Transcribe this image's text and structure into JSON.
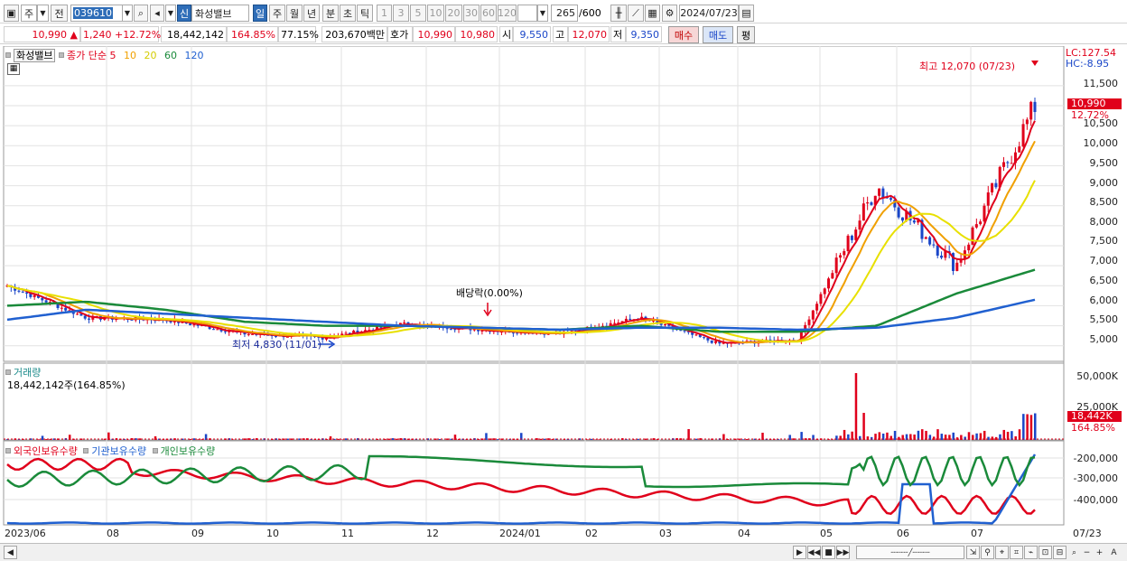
{
  "toolbar": {
    "period_main": "주",
    "prev_label": "전",
    "code": "039610",
    "brand_tag": "신",
    "stock_name": "화성밸브",
    "periods": [
      "일",
      "주",
      "월",
      "년",
      "분",
      "초",
      "틱"
    ],
    "active_period": "일",
    "intervals": [
      "1",
      "3",
      "5",
      "10",
      "20",
      "30",
      "60",
      "120"
    ],
    "count": "265",
    "count_max": "/600",
    "date": "2024/07/23"
  },
  "quote": {
    "price": "10,990",
    "price_arrow": "▲",
    "change": "1,240",
    "change_pct": "+12.72%",
    "volume": "18,442,142",
    "volume_ratio": "164.85%",
    "turnover": "77.15%",
    "value": "203,670백만",
    "hoga_label": "호가",
    "ask": "10,990",
    "bid": "10,980",
    "open_label": "시",
    "open": "9,550",
    "high_label": "고",
    "high": "12,070",
    "low_label": "저",
    "low": "9,350",
    "buy_label": "매수",
    "sell_label": "매도",
    "eval_label": "평"
  },
  "price_panel": {
    "legend_stock": "화성밸브",
    "legend_ma_label": "종가 단순",
    "ma_periods": [
      {
        "label": "5",
        "color": "#e0001b"
      },
      {
        "label": "10",
        "color": "#f0a000"
      },
      {
        "label": "20",
        "color": "#e8e000"
      },
      {
        "label": "60",
        "color": "#1a8a3a"
      },
      {
        "label": "120",
        "color": "#2060d0"
      }
    ],
    "lc": "LC:127.54",
    "hc": "HC:-8.95",
    "high_note": "최고 12,070 (07/23)",
    "low_note": "최저 4,830 (11/01)",
    "dividend_note": "배당락(0.00%)",
    "current_price_tag": "10,990",
    "current_pct_tag": "12.72%",
    "y_ticks": [
      "11,500",
      "10,500",
      "10,000",
      "9,500",
      "9,000",
      "8,500",
      "8,000",
      "7,500",
      "7,000",
      "6,500",
      "6,000",
      "5,500",
      "5,000"
    ]
  },
  "volume_panel": {
    "title": "거래량",
    "value_text": "18,442,142주(164.85%)",
    "y_ticks": [
      "50,000K",
      "25,000K"
    ],
    "tag_value": "18,442K",
    "tag_pct": "164.85%"
  },
  "holding_panel": {
    "legend": [
      {
        "label": "외국인보유수량",
        "color": "#e0001b"
      },
      {
        "label": "기관보유수량",
        "color": "#2060d0"
      },
      {
        "label": "개인보유수량",
        "color": "#1a8a3a"
      }
    ],
    "y_ticks": [
      "-200,000",
      "-300,000",
      "-400,000"
    ]
  },
  "x_axis": [
    "2023/06",
    "08",
    "09",
    "10",
    "11",
    "12",
    "2024/01",
    "02",
    "03",
    "04",
    "05",
    "06",
    "07"
  ],
  "x_axis_right": "07/23",
  "colors": {
    "up": "#e0001b",
    "down": "#1a46c8",
    "grid": "#e2e2e2",
    "accent_select": "#2e6db8"
  },
  "chart_data": {
    "type": "candlestick",
    "x": [
      "2023/06",
      "08",
      "09",
      "10",
      "11",
      "12",
      "2024/01",
      "02",
      "03",
      "04",
      "05",
      "06",
      "07",
      "07/23"
    ],
    "close": [
      6500,
      5700,
      5650,
      5300,
      5200,
      5550,
      5400,
      5300,
      5700,
      5050,
      5150,
      9000,
      7000,
      10990
    ],
    "ma120": [
      5650,
      5900,
      5800,
      5700,
      5600,
      5500,
      5450,
      5400,
      5450,
      5450,
      5400,
      5450,
      5700,
      6150
    ],
    "ma60": [
      6000,
      6100,
      5900,
      5600,
      5500,
      5500,
      5450,
      5400,
      5500,
      5350,
      5350,
      5500,
      6300,
      6900
    ],
    "ylim": [
      4700,
      12400
    ],
    "high_point": {
      "date": "07/23",
      "value": 12070
    },
    "low_point": {
      "date": "11/01",
      "value": 4830
    }
  }
}
